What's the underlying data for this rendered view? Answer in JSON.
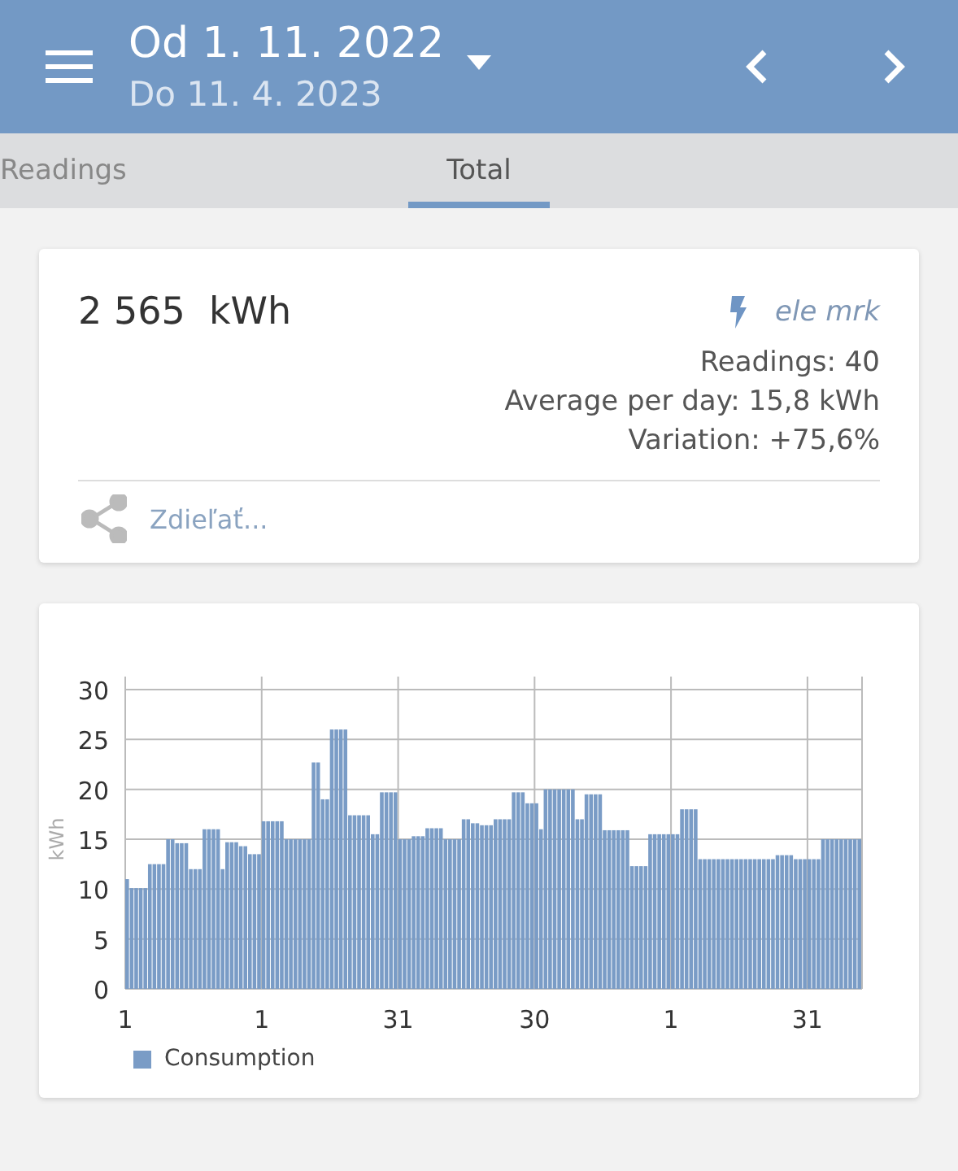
{
  "header": {
    "title": "Od 1. 11. 2022",
    "subtitle": "Do 11. 4. 2023"
  },
  "tabs": [
    {
      "label": "Readings",
      "selected": false
    },
    {
      "label": "Total",
      "selected": true
    }
  ],
  "summary": {
    "total": "2 565",
    "unit": "kWh",
    "meter": "ele mrk",
    "readings": "Readings: 40",
    "average": "Average per day: 15,8 kWh",
    "variation": "Variation: +75,6%",
    "share": "Zdieľať..."
  },
  "chart": {
    "chart_data": {
      "type": "bar",
      "grid": true,
      "ylabel": "kWh",
      "categories": [
        "1",
        null,
        null,
        null,
        null,
        null,
        null,
        null,
        null,
        null,
        null,
        null,
        null,
        null,
        null,
        null,
        null,
        null,
        null,
        null,
        null,
        null,
        null,
        null,
        null,
        null,
        null,
        null,
        null,
        null,
        "1",
        null,
        null,
        null,
        null,
        null,
        null,
        null,
        null,
        null,
        null,
        null,
        null,
        null,
        null,
        null,
        null,
        null,
        null,
        null,
        null,
        null,
        null,
        null,
        null,
        null,
        null,
        null,
        null,
        null,
        "31",
        null,
        null,
        null,
        null,
        null,
        null,
        null,
        null,
        null,
        null,
        null,
        null,
        null,
        null,
        null,
        null,
        null,
        null,
        null,
        null,
        null,
        null,
        null,
        null,
        null,
        null,
        null,
        null,
        null,
        "30",
        null,
        null,
        null,
        null,
        null,
        null,
        null,
        null,
        null,
        null,
        null,
        null,
        null,
        null,
        null,
        null,
        null,
        null,
        null,
        null,
        null,
        null,
        null,
        null,
        null,
        null,
        null,
        null,
        null,
        "1",
        null,
        null,
        null,
        null,
        null,
        null,
        null,
        null,
        null,
        null,
        null,
        null,
        null,
        null,
        null,
        null,
        null,
        null,
        null,
        null,
        null,
        null,
        null,
        null,
        null,
        null,
        null,
        null,
        null,
        "31",
        null,
        null,
        null,
        null,
        null,
        null,
        null,
        null,
        null,
        null,
        null
      ],
      "ylim": [
        0,
        30
      ],
      "yticks": [
        0,
        5,
        10,
        15,
        20,
        25,
        30
      ],
      "series": [
        {
          "name": "Consumption",
          "color": "#7a9cc6",
          "values": [
            11,
            10.1,
            10.1,
            10.1,
            10.1,
            12.5,
            12.5,
            12.5,
            12.5,
            15,
            15,
            14.6,
            14.6,
            14.6,
            12,
            12,
            12,
            16,
            16,
            16,
            16,
            12,
            14.7,
            14.7,
            14.7,
            14.3,
            14.3,
            13.5,
            13.5,
            13.5,
            16.8,
            16.8,
            16.8,
            16.8,
            16.8,
            15,
            15,
            15,
            15,
            15,
            15,
            22.7,
            22.7,
            19,
            19,
            26,
            26,
            26,
            26,
            17.4,
            17.4,
            17.4,
            17.4,
            17.4,
            15.5,
            15.5,
            19.7,
            19.7,
            19.7,
            19.7,
            15,
            15,
            15,
            15.3,
            15.3,
            15.3,
            16.1,
            16.1,
            16.1,
            16.1,
            15,
            15,
            15,
            15,
            17,
            17,
            16.6,
            16.6,
            16.4,
            16.4,
            16.4,
            17,
            17,
            17,
            17,
            19.7,
            19.7,
            19.7,
            18.6,
            18.6,
            18.6,
            16,
            20,
            20,
            20,
            20,
            20,
            20,
            20,
            17,
            17,
            19.5,
            19.5,
            19.5,
            19.5,
            15.9,
            15.9,
            15.9,
            15.9,
            15.9,
            15.9,
            12.3,
            12.3,
            12.3,
            12.3,
            15.5,
            15.5,
            15.5,
            15.5,
            15.5,
            15.5,
            15.5,
            18,
            18,
            18,
            18,
            13,
            13,
            13,
            13,
            13,
            13,
            13,
            13,
            13,
            13,
            13,
            13,
            13,
            13,
            13,
            13,
            13,
            13.4,
            13.4,
            13.4,
            13.4,
            13,
            13,
            13,
            13,
            13,
            13,
            15,
            15,
            15,
            15,
            15,
            15,
            15,
            15,
            15
          ]
        }
      ]
    }
  }
}
